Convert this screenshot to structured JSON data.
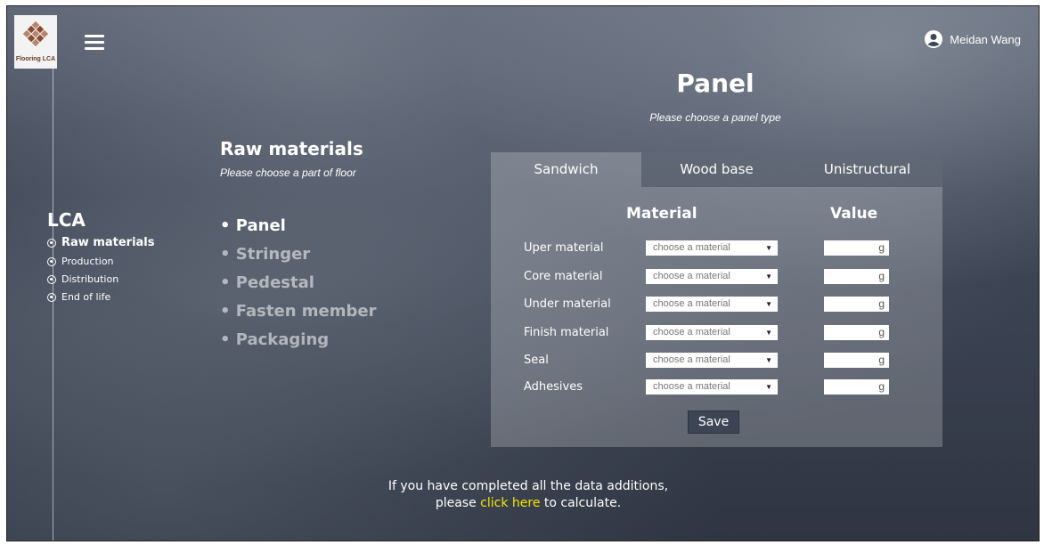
{
  "brand": {
    "logo_text": "Flooring LCA"
  },
  "user": {
    "name": "Meidan Wang"
  },
  "sidebar": {
    "title": "LCA",
    "items": [
      {
        "label": "Raw materials",
        "active": true
      },
      {
        "label": "Production"
      },
      {
        "label": "Distribution"
      },
      {
        "label": "End of life"
      }
    ]
  },
  "raw": {
    "title": "Raw materials",
    "subtitle": "Please choose a part of floor",
    "parts": [
      "Panel",
      "Stringer",
      "Pedestal",
      "Fasten member",
      "Packaging"
    ]
  },
  "panel": {
    "title": "Panel",
    "subtitle": "Please choose a panel type",
    "tabs": [
      "Sandwich",
      "Wood base",
      "Unistructural"
    ],
    "col_material": "Material",
    "col_value": "Value",
    "rows": [
      {
        "label": "Uper material",
        "select": "choose a material",
        "unit": "g"
      },
      {
        "label": "Core material",
        "select": "choose a material",
        "unit": "g"
      },
      {
        "label": "Under material",
        "select": "choose a material",
        "unit": "g"
      },
      {
        "label": "Finish material",
        "select": "choose a material",
        "unit": "g"
      },
      {
        "label": "Seal",
        "select": "choose a material",
        "unit": "g"
      },
      {
        "label": "Adhesives",
        "select": "choose a material",
        "unit": "g"
      }
    ],
    "save_label": "Save"
  },
  "footer": {
    "line1": "If you have completed all the data additions,",
    "line2_pre": "please ",
    "link": "click here",
    "line2_post": " to calculate."
  },
  "colors": {
    "link": "#f4e400",
    "logo_brown": "#8a4a35"
  }
}
